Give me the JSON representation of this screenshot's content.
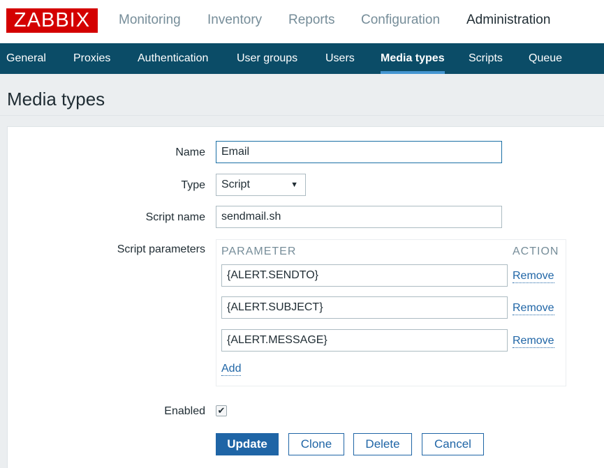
{
  "logo": "ZABBIX",
  "top_nav": [
    "Monitoring",
    "Inventory",
    "Reports",
    "Configuration",
    "Administration"
  ],
  "active_top": "Administration",
  "sub_nav": [
    "General",
    "Proxies",
    "Authentication",
    "User groups",
    "Users",
    "Media types",
    "Scripts",
    "Queue"
  ],
  "active_sub": "Media types",
  "page_title": "Media types",
  "form": {
    "name_label": "Name",
    "name_value": "Email",
    "type_label": "Type",
    "type_value": "Script",
    "script_name_label": "Script name",
    "script_name_value": "sendmail.sh",
    "params_label": "Script parameters",
    "params_header_param": "PARAMETER",
    "params_header_action": "ACTION",
    "params": [
      {
        "value": "{ALERT.SENDTO}",
        "action": "Remove"
      },
      {
        "value": "{ALERT.SUBJECT}",
        "action": "Remove"
      },
      {
        "value": "{ALERT.MESSAGE}",
        "action": "Remove"
      }
    ],
    "add_label": "Add",
    "enabled_label": "Enabled",
    "enabled_check": "✔"
  },
  "buttons": {
    "update": "Update",
    "clone": "Clone",
    "delete": "Delete",
    "cancel": "Cancel"
  },
  "colors": {
    "logo_red": "#d40000",
    "subnav_bg": "#0b4c67",
    "active_underline": "#4596d1",
    "link_blue": "#1f65a6"
  }
}
